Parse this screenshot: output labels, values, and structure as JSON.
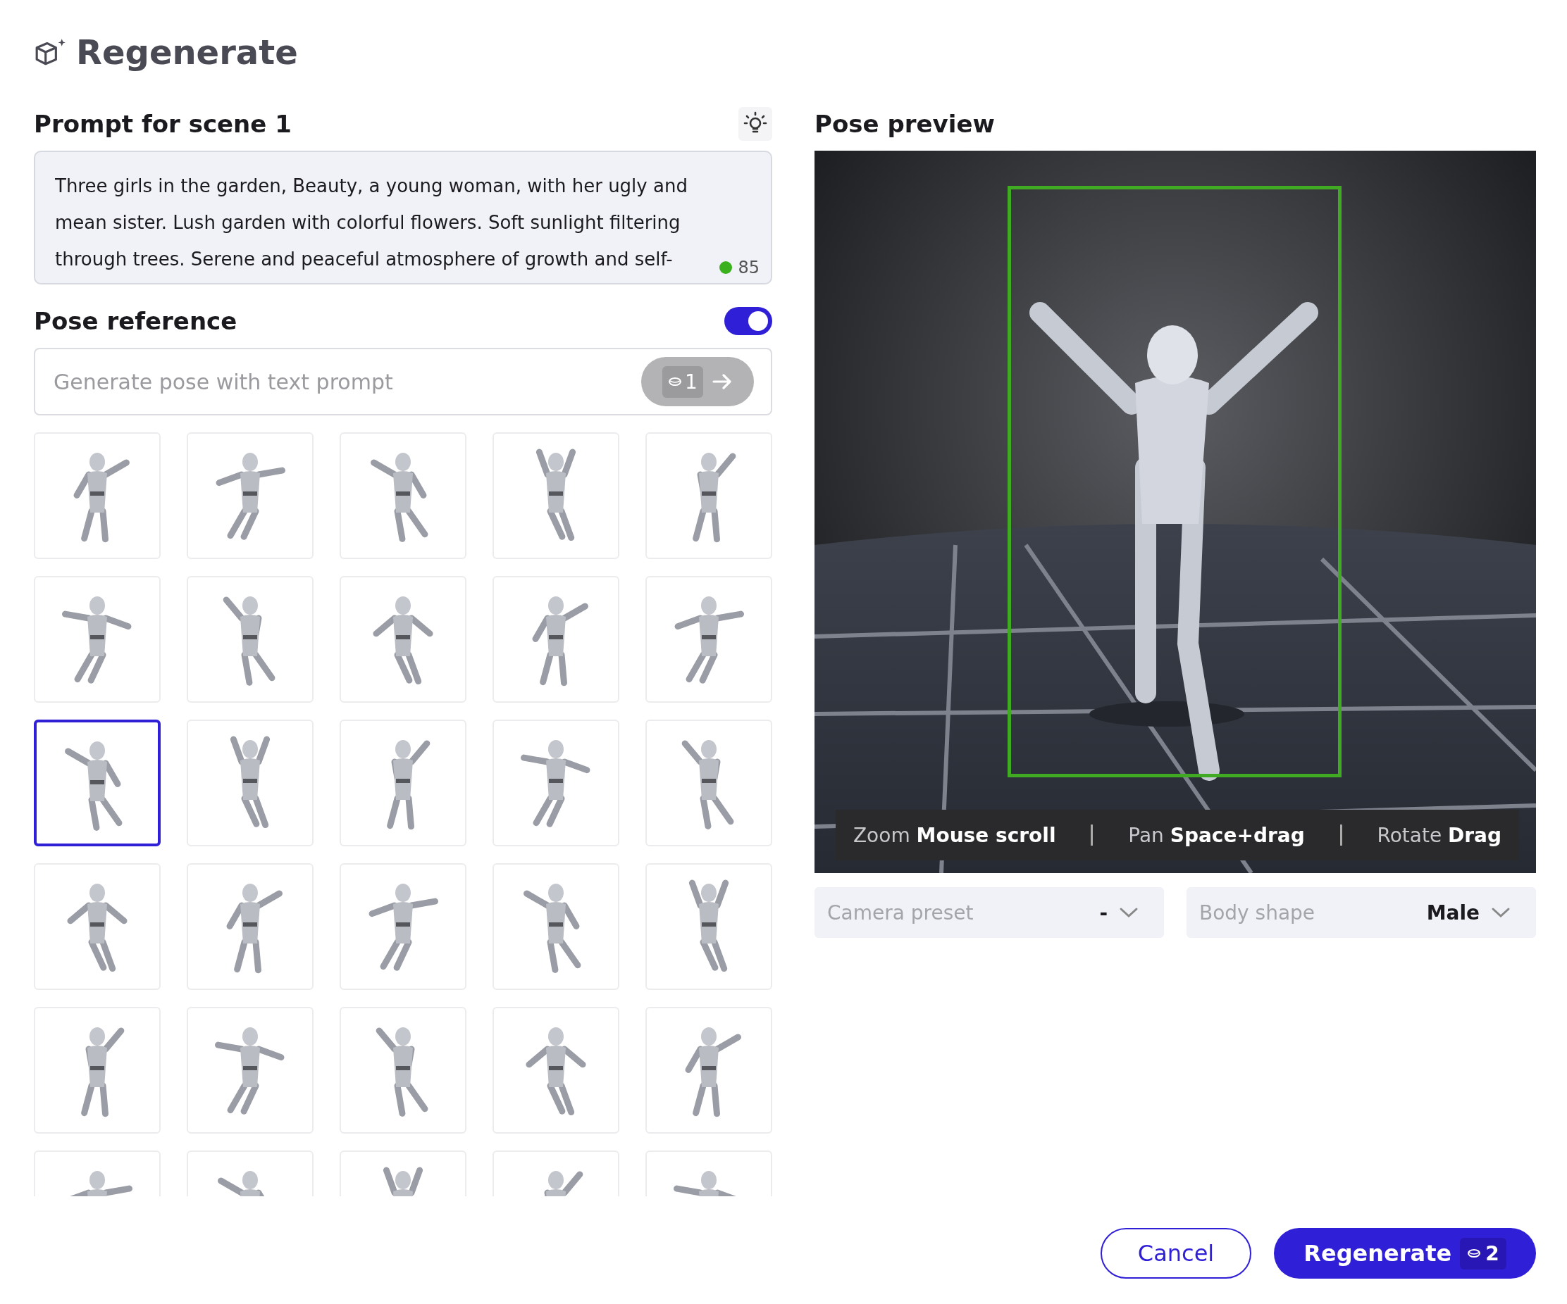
{
  "dialog": {
    "title": "Regenerate"
  },
  "prompt": {
    "label": "Prompt for scene 1",
    "text": "Three girls in the garden, Beauty, a young woman, with her ugly and mean sister. Lush garden with colorful flowers. Soft sunlight filtering through trees. Serene and peaceful atmosphere of growth and self-",
    "count": "85"
  },
  "pose_reference": {
    "label": "Pose reference",
    "on": true,
    "placeholder": "Generate pose with text prompt",
    "cost": "1"
  },
  "poses": [
    {
      "selected": false
    },
    {
      "selected": false
    },
    {
      "selected": false
    },
    {
      "selected": false
    },
    {
      "selected": false
    },
    {
      "selected": false
    },
    {
      "selected": false
    },
    {
      "selected": false
    },
    {
      "selected": false
    },
    {
      "selected": false
    },
    {
      "selected": true
    },
    {
      "selected": false
    },
    {
      "selected": false
    },
    {
      "selected": false
    },
    {
      "selected": false
    },
    {
      "selected": false
    },
    {
      "selected": false
    },
    {
      "selected": false
    },
    {
      "selected": false
    },
    {
      "selected": false
    },
    {
      "selected": false
    },
    {
      "selected": false
    },
    {
      "selected": false
    },
    {
      "selected": false
    },
    {
      "selected": false
    },
    {
      "selected": false
    },
    {
      "selected": false
    },
    {
      "selected": false
    },
    {
      "selected": false
    },
    {
      "selected": false
    }
  ],
  "preview": {
    "label": "Pose preview",
    "hints": [
      {
        "action": "Zoom",
        "control": "Mouse scroll"
      },
      {
        "action": "Pan",
        "control": "Space+drag"
      },
      {
        "action": "Rotate",
        "control": "Drag"
      }
    ]
  },
  "selects": [
    {
      "label": "Camera preset",
      "value": "-"
    },
    {
      "label": "Body shape",
      "value": "Male"
    }
  ],
  "buttons": {
    "cancel": "Cancel",
    "confirm": "Regenerate",
    "cost": "2"
  }
}
